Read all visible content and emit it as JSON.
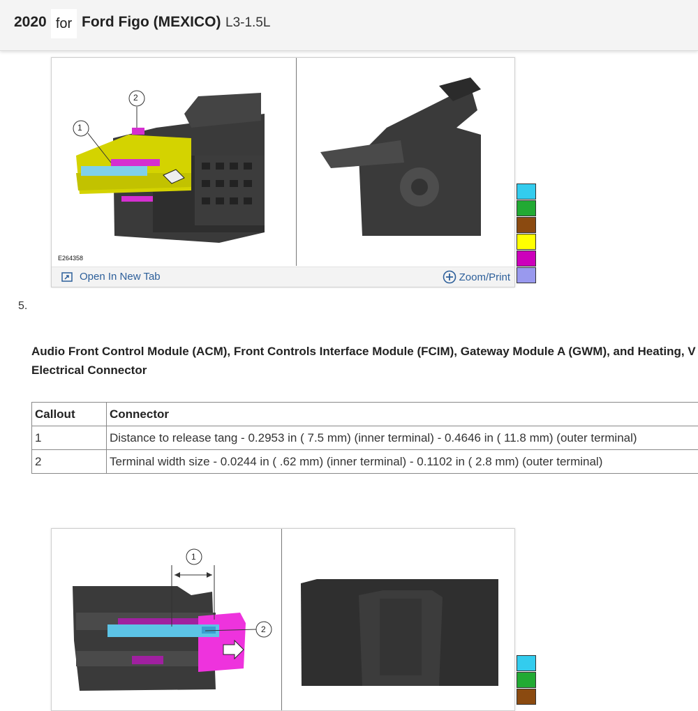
{
  "header": {
    "year": "2020",
    "for_word": "for",
    "model": "Ford Figo (MEXICO)",
    "engine": "L3-1.5L"
  },
  "figure1": {
    "figure_id": "E264358",
    "callouts": [
      "1",
      "2"
    ],
    "open_label": "Open In New Tab",
    "zoom_label": "Zoom/Print"
  },
  "swatch_colors": [
    "#33ccee",
    "#22aa33",
    "#8b4a10",
    "#ffff00",
    "#cc00bb",
    "#9999ee"
  ],
  "step": {
    "number": "5.",
    "title_line1": "Audio Front Control Module (ACM), Front Controls Interface Module (FCIM), Gateway Module A (GWM), and Heating, V",
    "title_line2": "Electrical Connector"
  },
  "table": {
    "headers": [
      "Callout",
      "Connector"
    ],
    "rows": [
      [
        "1",
        "Distance to release tang - 0.2953 in ( 7.5 mm) (inner terminal) - 0.4646 in ( 11.8 mm) (outer terminal)"
      ],
      [
        "2",
        "Terminal width size - 0.0244 in ( .62 mm) (inner terminal) - 0.1102 in ( 2.8 mm) (outer terminal)"
      ]
    ]
  },
  "figure2": {
    "callouts": [
      "1",
      "2"
    ]
  }
}
